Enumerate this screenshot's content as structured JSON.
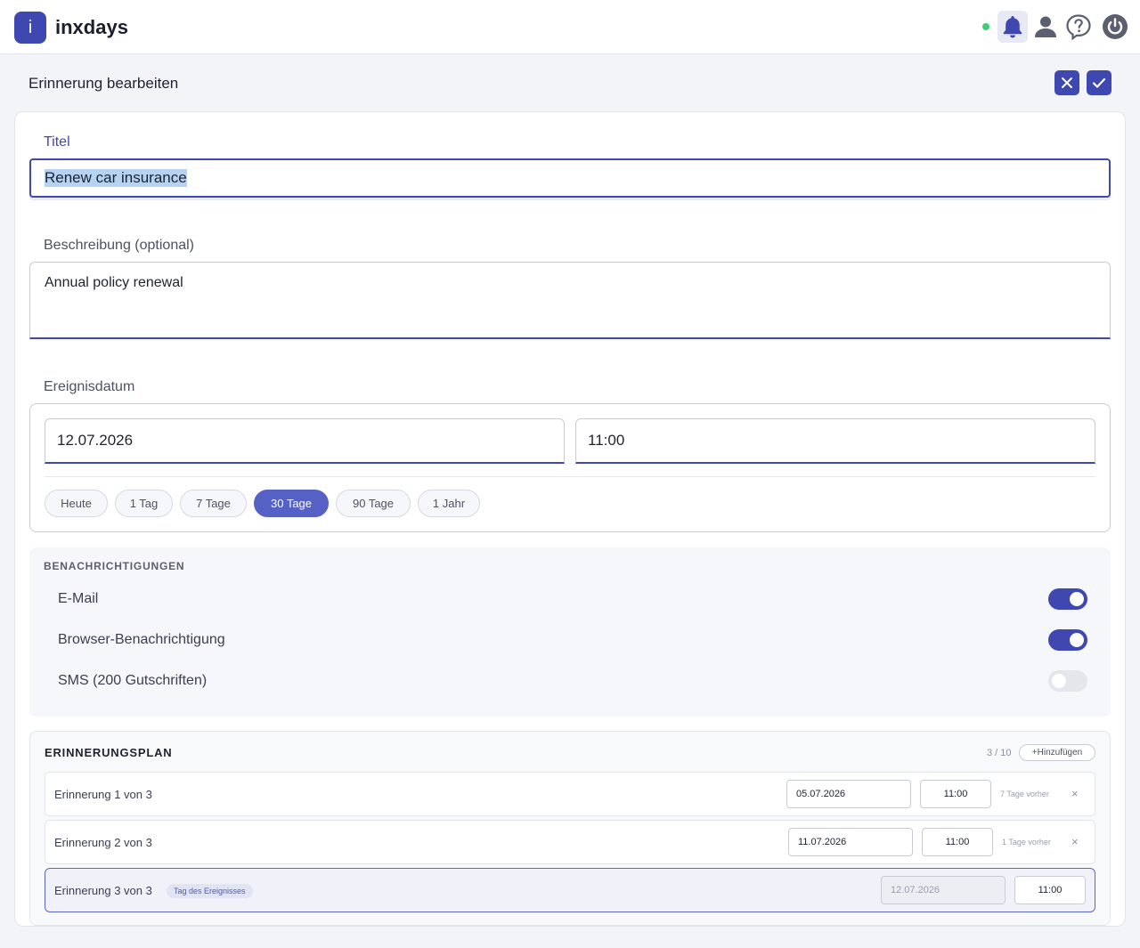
{
  "app": {
    "logo_letter": "i",
    "name": "inxdays",
    "status_color": "#3ecf72",
    "icons": [
      "bell-icon",
      "user-icon",
      "help-icon",
      "power-icon"
    ]
  },
  "page": {
    "title": "Erinnerung bearbeiten",
    "cancel_icon": "close-icon",
    "confirm_icon": "check-icon"
  },
  "form": {
    "title_label": "Titel",
    "title_value": "Renew car insurance",
    "description_label": "Beschreibung (optional)",
    "description_value": "Annual policy renewal",
    "event_date_label": "Ereignisdatum",
    "date_value": "12.07.2026",
    "time_value": "11:00",
    "quick_ranges": [
      {
        "label": "Heute",
        "active": false
      },
      {
        "label": "1 Tag",
        "active": false
      },
      {
        "label": "7 Tage",
        "active": false
      },
      {
        "label": "30 Tage",
        "active": true
      },
      {
        "label": "90 Tage",
        "active": false
      },
      {
        "label": "1 Jahr",
        "active": false
      }
    ]
  },
  "notifications": {
    "heading": "BENACHRICHTIGUNGEN",
    "items": [
      {
        "label": "E-Mail",
        "enabled": true
      },
      {
        "label": "Browser-Benachrichtigung",
        "enabled": true
      },
      {
        "label": "SMS (200 Gutschriften)",
        "enabled": false
      }
    ]
  },
  "plan": {
    "heading": "ERINNERUNGSPLAN",
    "count": "3 / 10",
    "add_label": "+Hinzufügen",
    "reminders": [
      {
        "label": "Erinnerung 1 von 3",
        "date": "05.07.2026",
        "time": "11:00",
        "before": "7 Tage vorher",
        "remove": "×"
      },
      {
        "label": "Erinnerung 2 von 3",
        "date": "11.07.2026",
        "time": "11:00",
        "before": "1 Tage vorher",
        "remove": "×"
      },
      {
        "label": "Erinnerung 3 von 3",
        "tag": "Tag des Ereignisses",
        "date": "12.07.2026",
        "time": "11:00"
      }
    ]
  },
  "colors": {
    "accent": "#3f48b0",
    "chip_active": "#5561c4"
  }
}
